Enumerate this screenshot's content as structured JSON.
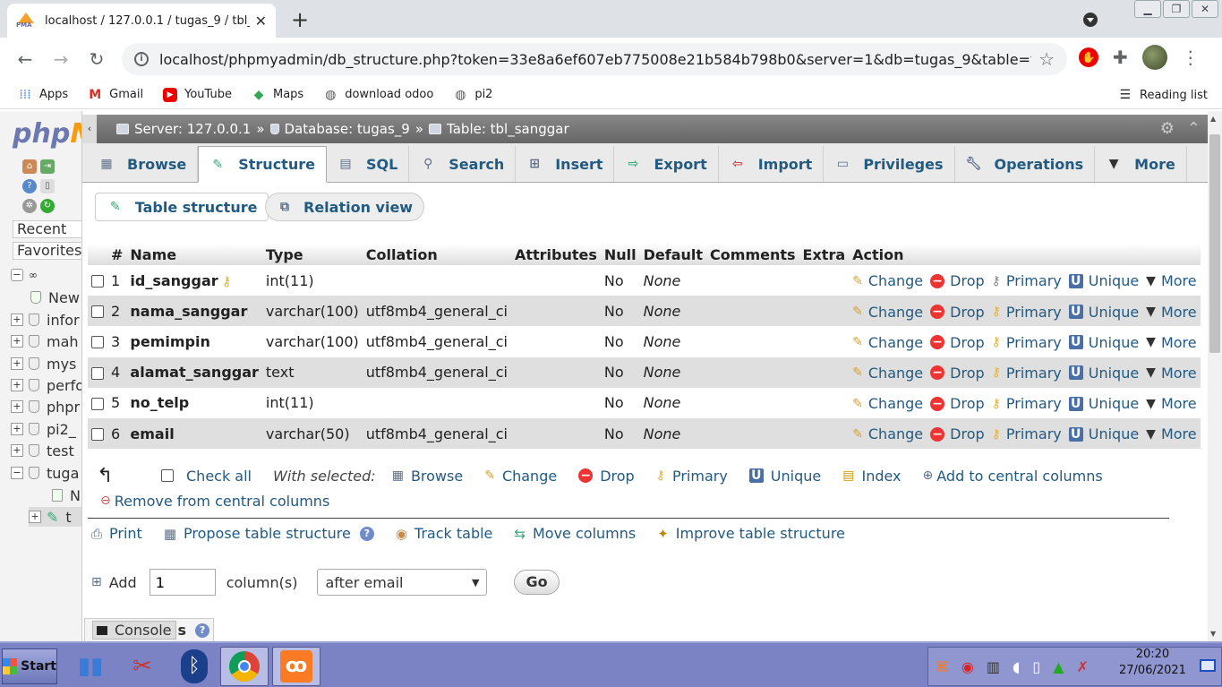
{
  "browser": {
    "tab_title": "localhost / 127.0.0.1 / tugas_9 / tbl_sanggar",
    "favicon_text": "PMA",
    "url": "localhost/phpmyadmin/db_structure.php?token=33e8a6ef607eb775008e21b584b798b0&server=1&db=tugas_9&table=tbl...",
    "bookmarks": [
      {
        "label": "Apps",
        "icon": "apps-grid-icon"
      },
      {
        "label": "Gmail",
        "icon": "gmail-icon"
      },
      {
        "label": "YouTube",
        "icon": "youtube-icon"
      },
      {
        "label": "Maps",
        "icon": "maps-icon"
      },
      {
        "label": "download odoo",
        "icon": "globe-icon"
      },
      {
        "label": "pi2",
        "icon": "globe-icon"
      }
    ],
    "reading_list": "Reading list"
  },
  "nav": {
    "logo_main": "php",
    "logo_accent": "M",
    "recent": "Recent",
    "favorites": "Favorites",
    "tree": [
      {
        "label": "New",
        "type": "new"
      },
      {
        "label": "infor",
        "type": "db"
      },
      {
        "label": "mah",
        "type": "db"
      },
      {
        "label": "mys",
        "type": "db"
      },
      {
        "label": "perfo",
        "type": "db"
      },
      {
        "label": "phpr",
        "type": "db"
      },
      {
        "label": "pi2_",
        "type": "db"
      },
      {
        "label": "test",
        "type": "db"
      },
      {
        "label": "tuga",
        "type": "db-open"
      },
      {
        "label": "N",
        "type": "sub-new"
      },
      {
        "label": "t",
        "type": "sub-table"
      }
    ]
  },
  "breadcrumb": {
    "server": "Server: 127.0.0.1",
    "database": "Database: tugas_9",
    "table": "Table: tbl_sanggar",
    "separator": "»"
  },
  "tabs": [
    {
      "label": "Browse",
      "icon": "browse-icon"
    },
    {
      "label": "Structure",
      "icon": "structure-icon",
      "active": true
    },
    {
      "label": "SQL",
      "icon": "sql-icon"
    },
    {
      "label": "Search",
      "icon": "search-icon"
    },
    {
      "label": "Insert",
      "icon": "insert-icon"
    },
    {
      "label": "Export",
      "icon": "export-icon"
    },
    {
      "label": "Import",
      "icon": "import-icon"
    },
    {
      "label": "Privileges",
      "icon": "privileges-icon"
    },
    {
      "label": "Operations",
      "icon": "wrench-icon"
    },
    {
      "label": "More",
      "icon": "chevron-down-icon"
    }
  ],
  "subtabs": {
    "table_structure": "Table structure",
    "relation_view": "Relation view"
  },
  "table": {
    "headers": [
      "#",
      "Name",
      "Type",
      "Collation",
      "Attributes",
      "Null",
      "Default",
      "Comments",
      "Extra",
      "Action"
    ],
    "rows": [
      {
        "num": "1",
        "name": "id_sanggar",
        "primary_key": true,
        "type": "int(11)",
        "collation": "",
        "attributes": "",
        "null": "No",
        "default": "None",
        "comments": "",
        "extra": ""
      },
      {
        "num": "2",
        "name": "nama_sanggar",
        "primary_key": false,
        "type": "varchar(100)",
        "collation": "utf8mb4_general_ci",
        "attributes": "",
        "null": "No",
        "default": "None",
        "comments": "",
        "extra": ""
      },
      {
        "num": "3",
        "name": "pemimpin",
        "primary_key": false,
        "type": "varchar(100)",
        "collation": "utf8mb4_general_ci",
        "attributes": "",
        "null": "No",
        "default": "None",
        "comments": "",
        "extra": ""
      },
      {
        "num": "4",
        "name": "alamat_sanggar",
        "primary_key": false,
        "type": "text",
        "collation": "utf8mb4_general_ci",
        "attributes": "",
        "null": "No",
        "default": "None",
        "comments": "",
        "extra": ""
      },
      {
        "num": "5",
        "name": "no_telp",
        "primary_key": false,
        "type": "int(11)",
        "collation": "",
        "attributes": "",
        "null": "No",
        "default": "None",
        "comments": "",
        "extra": ""
      },
      {
        "num": "6",
        "name": "email",
        "primary_key": false,
        "type": "varchar(50)",
        "collation": "utf8mb4_general_ci",
        "attributes": "",
        "null": "No",
        "default": "None",
        "comments": "",
        "extra": ""
      }
    ],
    "actions": {
      "change": "Change",
      "drop": "Drop",
      "primary": "Primary",
      "unique": "Unique",
      "more": "More"
    }
  },
  "bulk": {
    "check_all": "Check all",
    "with_selected": "With selected:",
    "browse": "Browse",
    "change": "Change",
    "drop": "Drop",
    "primary": "Primary",
    "unique": "Unique",
    "index": "Index",
    "add_central": "Add to central columns",
    "remove_central": "Remove from central columns"
  },
  "tools": {
    "print": "Print",
    "propose": "Propose table structure",
    "track": "Track table",
    "move": "Move columns",
    "improve": "Improve table structure"
  },
  "add_column": {
    "label": "Add",
    "count": "1",
    "unit": "column(s)",
    "position": "after email",
    "go": "Go"
  },
  "console": {
    "label": "Console",
    "trailing": "s"
  },
  "taskbar": {
    "start": "Start",
    "time": "20:20",
    "date": "27/06/2021"
  },
  "colors": {
    "link": "#235a81",
    "serverbar": "#777777",
    "taskbar": "#7b83c4"
  }
}
